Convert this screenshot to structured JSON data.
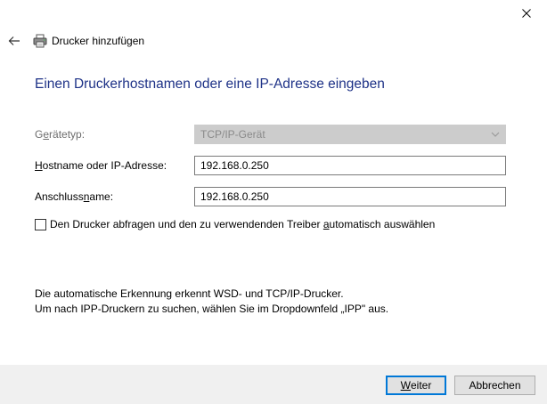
{
  "window": {
    "title": "Drucker hinzufügen"
  },
  "main": {
    "heading": "Einen Druckerhostnamen oder eine IP-Adresse eingeben"
  },
  "form": {
    "device_type": {
      "label_pre": "G",
      "label_accel": "e",
      "label_post": "rätetyp:",
      "value": "TCP/IP-Gerät",
      "enabled": false
    },
    "hostname": {
      "label_pre": "",
      "label_accel": "H",
      "label_post": "ostname oder IP-Adresse:",
      "value": "192.168.0.250"
    },
    "port_name": {
      "label_pre": "Anschluss",
      "label_accel": "n",
      "label_post": "ame:",
      "value": "192.168.0.250"
    },
    "auto_detect": {
      "label_pre": "Den Drucker abfragen und den zu verwendenden Treiber ",
      "label_accel": "a",
      "label_post": "utomatisch auswählen",
      "checked": false
    }
  },
  "info": {
    "line1": "Die automatische Erkennung erkennt WSD- und TCP/IP-Drucker.",
    "line2": "Um nach IPP-Druckern zu suchen, wählen Sie im Dropdownfeld „IPP\" aus."
  },
  "footer": {
    "next_accel": "W",
    "next_rest": "eiter",
    "cancel_label": "Abbrechen"
  },
  "colors": {
    "heading": "#1e3287",
    "primary_border": "#0078d7",
    "footer_bg": "#f0f0f0",
    "disabled_bg": "#cccccc"
  },
  "icons": {
    "close": "close-icon",
    "back": "back-arrow-icon",
    "printer": "printer-icon",
    "dropdown": "chevron-down-icon"
  }
}
